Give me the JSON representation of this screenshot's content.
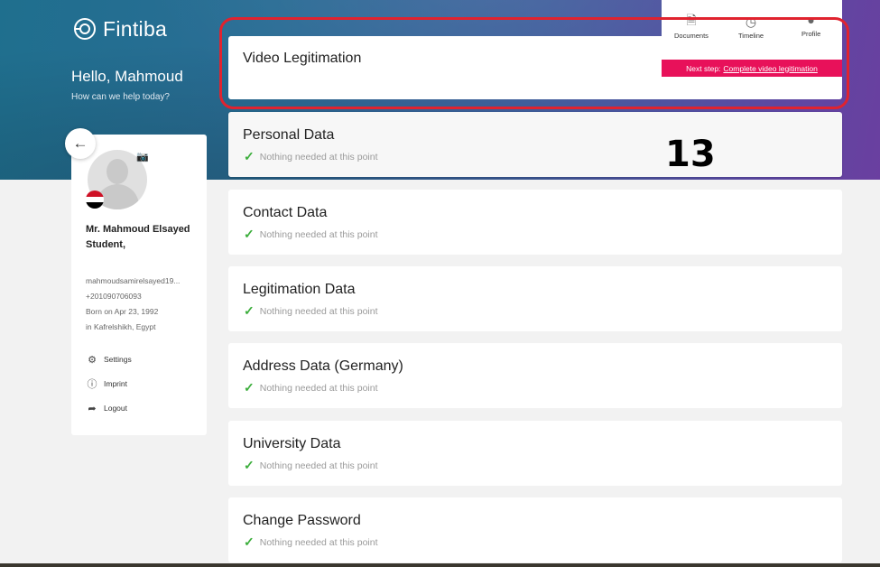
{
  "brand": {
    "name": "Fintiba"
  },
  "greeting": {
    "hello": "Hello, Mahmoud",
    "sub": "How can we help today?"
  },
  "profile": {
    "name": "Mr. Mahmoud Elsayed Student,",
    "email": "mahmoudsamirelsayed19...",
    "phone": "+201090706093",
    "born": "Born on Apr 23, 1992",
    "birthplace": "in Kafrelshikh, Egypt",
    "flag_colors": [
      "#ce1126",
      "#ffffff",
      "#000000"
    ]
  },
  "menu": [
    {
      "label": "Settings",
      "icon": "gear-icon"
    },
    {
      "label": "Imprint",
      "icon": "info-icon"
    },
    {
      "label": "Logout",
      "icon": "logout-icon"
    }
  ],
  "topnav": [
    {
      "label": "Documents",
      "icon": "documents-icon"
    },
    {
      "label": "Timeline",
      "icon": "timeline-icon"
    },
    {
      "label": "Profile",
      "icon": "profile-icon"
    }
  ],
  "next_step": {
    "prefix": "Next step:",
    "link": "Complete video legitimation"
  },
  "video_card": {
    "title": "Video Legitimation"
  },
  "annotation": "13",
  "sections": [
    {
      "title": "Personal Data",
      "status": "Nothing needed at this point"
    },
    {
      "title": "Contact Data",
      "status": "Nothing needed at this point"
    },
    {
      "title": "Legitimation Data",
      "status": "Nothing needed at this point"
    },
    {
      "title": "Address Data (Germany)",
      "status": "Nothing needed at this point"
    },
    {
      "title": "University Data",
      "status": "Nothing needed at this point"
    },
    {
      "title": "Change Password",
      "status": "Nothing needed at this point"
    }
  ],
  "colors": {
    "accent": "#e8115a",
    "highlight": "#e0232f",
    "check": "#3cae3c"
  }
}
